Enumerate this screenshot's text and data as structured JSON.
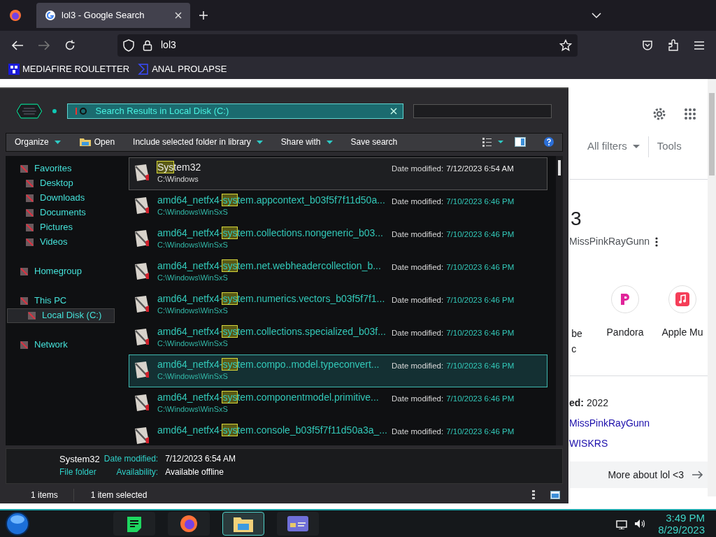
{
  "browser": {
    "tabs": [
      {
        "title": "lol3 - Google Search",
        "selected": true
      }
    ],
    "address": "lol3",
    "bookmarks": [
      "MEDIAFIRE ROULETTER",
      "ANAL PROLAPSE"
    ]
  },
  "explorer": {
    "address": "Search Results in Local Disk (C:)",
    "toolbar": [
      {
        "label": "Organize",
        "has_menu": true,
        "kind": "menu"
      },
      {
        "label": "Open",
        "has_menu": false,
        "kind": "open"
      },
      {
        "label": "Include selected folder in library",
        "has_menu": true,
        "kind": "menu"
      },
      {
        "label": "Share with",
        "has_menu": true,
        "kind": "menu"
      },
      {
        "label": "Save search",
        "has_menu": false,
        "kind": "menu"
      }
    ],
    "sidebar": [
      {
        "label": "Favorites",
        "selected": false,
        "children": [
          {
            "label": "Desktop",
            "selected": false
          },
          {
            "label": "Downloads",
            "selected": false
          },
          {
            "label": "Documents",
            "selected": false
          },
          {
            "label": "Pictures",
            "selected": false
          },
          {
            "label": "Videos",
            "selected": false
          }
        ]
      },
      {
        "label": "Homegroup",
        "selected": false
      },
      {
        "label": "This PC",
        "selected": false,
        "children": [
          {
            "label": "Local Disk (C:)",
            "selected": true
          }
        ]
      },
      {
        "label": "Network",
        "selected": false
      }
    ],
    "results": [
      {
        "match": "Sys",
        "rest": "tem32",
        "path": "C:\\Windows",
        "date_label": "Date modified:",
        "date": "7/12/2023 6:54 AM",
        "selected": true,
        "hovered": false
      },
      {
        "prefix": "amd64_netfx4-",
        "match": "sys",
        "rest": "tem.appcontext_b03f5f7f11d50a...",
        "path": "C:\\Windows\\WinSxS",
        "date_label": "Date modified:",
        "date": "7/10/2023 6:46 PM",
        "selected": false,
        "hovered": false
      },
      {
        "prefix": "amd64_netfx4-",
        "match": "sys",
        "rest": "tem.collections.nongeneric_b03...",
        "path": "C:\\Windows\\WinSxS",
        "date_label": "Date modified:",
        "date": "7/10/2023 6:46 PM",
        "selected": false,
        "hovered": false
      },
      {
        "prefix": "amd64_netfx4-",
        "match": "sys",
        "rest": "tem.net.webheadercollection_b...",
        "path": "C:\\Windows\\WinSxS",
        "date_label": "Date modified:",
        "date": "7/10/2023 6:46 PM",
        "selected": false,
        "hovered": false
      },
      {
        "prefix": "amd64_netfx4-",
        "match": "sys",
        "rest": "tem.numerics.vectors_b03f5f7f1...",
        "path": "C:\\Windows\\WinSxS",
        "date_label": "Date modified:",
        "date": "7/10/2023 6:46 PM",
        "selected": false,
        "hovered": false
      },
      {
        "prefix": "amd64_netfx4-",
        "match": "sys",
        "rest": "tem.collections.specialized_b03f...",
        "path": "C:\\Windows\\WinSxS",
        "date_label": "Date modified:",
        "date": "7/10/2023 6:46 PM",
        "selected": false,
        "hovered": false
      },
      {
        "prefix": "amd64_netfx4-",
        "match": "sys",
        "rest": "tem.compo..model.typeconvert...",
        "path": "C:\\Windows\\WinSxS",
        "date_label": "Date modified:",
        "date": "7/10/2023 6:46 PM",
        "selected": false,
        "hovered": true
      },
      {
        "prefix": "amd64_netfx4-",
        "match": "sys",
        "rest": "tem.componentmodel.primitive...",
        "path": "C:\\Windows\\WinSxS",
        "date_label": "Date modified:",
        "date": "7/10/2023 6:46 PM",
        "selected": false,
        "hovered": false
      },
      {
        "prefix": "amd64_netfx4-",
        "match": "sys",
        "rest": "tem.console_b03f5f7f11d50a3a_...",
        "date_label": "Date modified:",
        "date": "7/10/2023 6:46 PM",
        "selected": false,
        "hovered": false
      }
    ],
    "details": {
      "name": "System32",
      "type": "File folder",
      "fields": [
        {
          "label": "Date modified:",
          "value": "7/12/2023 6:54 AM"
        },
        {
          "label": "Availability:",
          "value": "Available offline"
        }
      ]
    },
    "status_bar": [
      "1 items",
      "1 item selected"
    ]
  },
  "google": {
    "filters": [
      "All filters",
      "Tools"
    ],
    "heading": "3",
    "byline": "MissPinkRayGunn",
    "services": [
      {
        "label": "be\nc",
        "kind": "partial"
      },
      {
        "label": "Pandora",
        "kind": "pandora"
      },
      {
        "label": "Apple Mu",
        "kind": "apple"
      }
    ],
    "facts": [
      {
        "text": "**ed:** 2022",
        "kind": "text"
      },
      {
        "text": "MissPinkRayGunn",
        "kind": "link"
      },
      {
        "text": "WISKRS",
        "kind": "link"
      }
    ],
    "more": "More about lol <3"
  },
  "taskbar": {
    "apps": [
      {
        "kind": "notes",
        "selected": false
      },
      {
        "kind": "firefox",
        "selected": false
      },
      {
        "kind": "explorer",
        "selected": true
      },
      {
        "kind": "card",
        "selected": false
      }
    ],
    "time": "3:49 PM",
    "date": "8/29/2023"
  }
}
